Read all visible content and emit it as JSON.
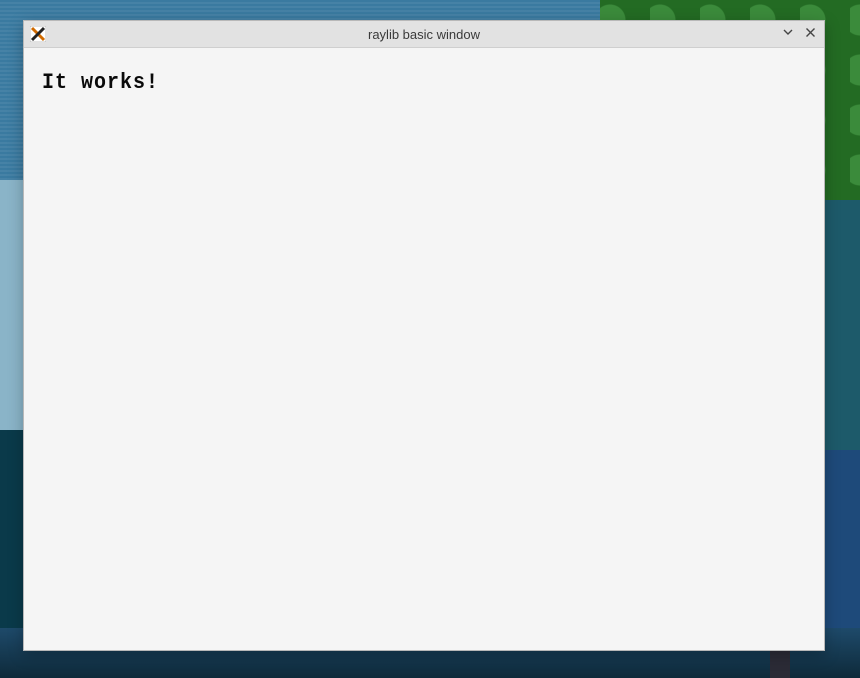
{
  "window": {
    "title": "raylib basic window",
    "app_icon": "x11-logo-icon"
  },
  "content": {
    "message": "It works!"
  },
  "colors": {
    "titlebar_bg": "#e2e2e2",
    "client_bg": "#f5f5f5",
    "text_color": "#0a0a0a"
  }
}
